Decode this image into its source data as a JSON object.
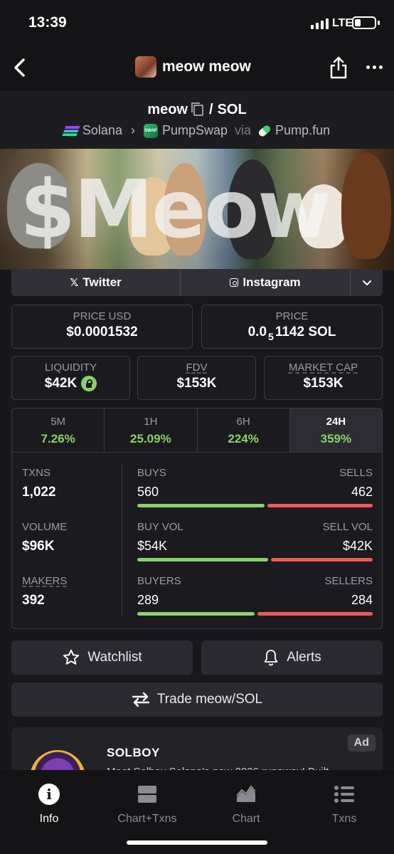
{
  "status_bar": {
    "time": "13:39",
    "network": "LTE"
  },
  "nav": {
    "title": "meow meow"
  },
  "pair": {
    "base": "meow",
    "separator": "/",
    "quote": "SOL"
  },
  "chain": {
    "network": "Solana",
    "dex": "PumpSwap",
    "via": "via",
    "launchpad": "Pump.fun"
  },
  "banner": {
    "text": "$Meow"
  },
  "social": {
    "twitter": "Twitter",
    "instagram": "Instagram"
  },
  "price": {
    "usd_label": "PRICE USD",
    "usd_value": "$0.0001532",
    "native_label": "PRICE",
    "native_prefix": "0.0",
    "native_zeros": "5",
    "native_rest": "1142 SOL"
  },
  "metrics": {
    "liquidity_label": "LIQUIDITY",
    "liquidity_value": "$42K",
    "fdv_label": "FDV",
    "fdv_value": "$153K",
    "mcap_label": "MARKET CAP",
    "mcap_value": "$153K"
  },
  "timeframes": [
    {
      "label": "5M",
      "value": "7.26%"
    },
    {
      "label": "1H",
      "value": "25.09%"
    },
    {
      "label": "6H",
      "value": "224%"
    },
    {
      "label": "24H",
      "value": "359%"
    }
  ],
  "active_timeframe": "24H",
  "stats": {
    "txns_label": "TXNS",
    "txns_value": "1,022",
    "volume_label": "VOLUME",
    "volume_value": "$96K",
    "makers_label": "MAKERS",
    "makers_value": "392",
    "buys_label": "BUYS",
    "buys_value": "560",
    "sells_label": "SELLS",
    "sells_value": "462",
    "buy_vol_label": "BUY VOL",
    "buy_vol_value": "$54K",
    "sell_vol_label": "SELL VOL",
    "sell_vol_value": "$42K",
    "buyers_label": "BUYERS",
    "buyers_value": "289",
    "sellers_label": "SELLERS",
    "sellers_value": "284",
    "buy_ratio": 0.548,
    "buy_vol_ratio": 0.563,
    "buyers_ratio": 0.504
  },
  "actions": {
    "watchlist": "Watchlist",
    "alerts": "Alerts",
    "trade": "Trade meow/SOL"
  },
  "ad": {
    "badge": "Ad",
    "brand": "SOLBOY",
    "description": "Meet Solboy Solana's new 2026 runaway! Built"
  },
  "tabbar": [
    {
      "label": "Info",
      "icon": "info-icon"
    },
    {
      "label": "Chart+Txns",
      "icon": "split-view-icon"
    },
    {
      "label": "Chart",
      "icon": "area-chart-icon"
    },
    {
      "label": "Txns",
      "icon": "list-icon"
    }
  ],
  "colors": {
    "positive": "#8bd16b",
    "negative": "#ec5a5a",
    "background": "#18181b"
  }
}
